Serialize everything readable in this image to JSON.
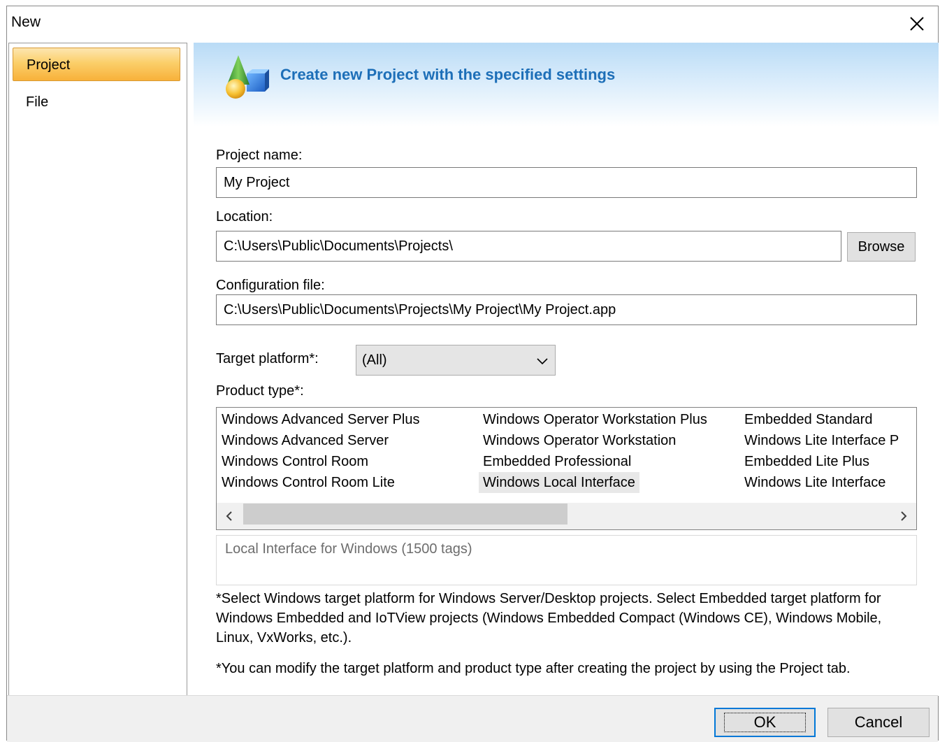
{
  "window": {
    "title": "New"
  },
  "sidebar": {
    "items": [
      {
        "label": "Project",
        "selected": true
      },
      {
        "label": "File",
        "selected": false
      }
    ]
  },
  "banner": {
    "text": "Create new Project with the specified settings",
    "icon": "project-shapes-icon"
  },
  "form": {
    "project_name_label": "Project name:",
    "project_name_value": "My Project",
    "location_label": "Location:",
    "location_value": "C:\\Users\\Public\\Documents\\Projects\\",
    "browse_label": "Browse",
    "config_label": "Configuration file:",
    "config_value": "C:\\Users\\Public\\Documents\\Projects\\My Project\\My Project.app",
    "target_platform_label": "Target platform*:",
    "target_platform_value": "(All)",
    "product_type_label": "Product type*:"
  },
  "product_types": {
    "columns": [
      [
        "Windows Advanced Server Plus",
        "Windows Advanced Server",
        "Windows Control Room",
        "Windows Control Room Lite"
      ],
      [
        "Windows Operator Workstation Plus",
        "Windows Operator Workstation",
        "Embedded Professional",
        "Windows Local Interface"
      ],
      [
        "Embedded Standard",
        "Windows Lite Interface P",
        "Embedded Lite Plus",
        "Windows Lite Interface"
      ]
    ],
    "selected": "Windows Local Interface",
    "description": "Local Interface for Windows (1500 tags)"
  },
  "notes": {
    "note1": "*Select Windows target platform for Windows Server/Desktop projects. Select Embedded target platform for Windows Embedded and IoTView projects (Windows Embedded Compact (Windows CE), Windows Mobile, Linux, VxWorks, etc.).",
    "note2": "*You can modify the target platform and product type after creating the project by using the Project tab."
  },
  "footer": {
    "ok_label": "OK",
    "cancel_label": "Cancel"
  },
  "colors": {
    "accent": "#0078d7",
    "banner_text": "#1d6fb8",
    "selected_sidebar": "#fbcf6a"
  }
}
